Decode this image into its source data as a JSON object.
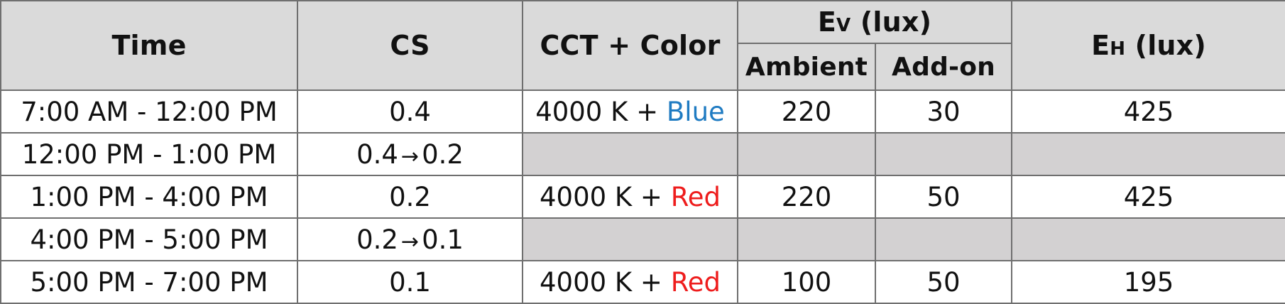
{
  "table": {
    "headers": {
      "time": "Time",
      "cs": "CS",
      "cct_color": "CCT + Color",
      "ev_main": "E",
      "ev_sub": "V",
      "ev_unit": "(lux)",
      "ev_ambient": "Ambient",
      "ev_addon": "Add-on",
      "eh_main": "E",
      "eh_sub": "H",
      "eh_unit": "(lux)"
    },
    "rows": [
      {
        "time": "7:00 AM - 12:00 PM",
        "cs_from": "0.4",
        "cs_arrow": "",
        "cs_to": "",
        "cct": "4000 K +",
        "color": "Blue",
        "color_class": "color-blue",
        "ambient": "220",
        "addon": "30",
        "eh": "425",
        "shaded": false
      },
      {
        "time": "12:00 PM - 1:00 PM",
        "cs_from": "0.4",
        "cs_arrow": "→",
        "cs_to": "0.2",
        "cct": "",
        "color": "",
        "color_class": "",
        "ambient": "",
        "addon": "",
        "eh": "",
        "shaded": true
      },
      {
        "time": "1:00 PM - 4:00 PM",
        "cs_from": "0.2",
        "cs_arrow": "",
        "cs_to": "",
        "cct": "4000 K +",
        "color": "Red",
        "color_class": "color-red",
        "ambient": "220",
        "addon": "50",
        "eh": "425",
        "shaded": false
      },
      {
        "time": "4:00 PM - 5:00 PM",
        "cs_from": "0.2",
        "cs_arrow": "→",
        "cs_to": "0.1",
        "cct": "",
        "color": "",
        "color_class": "",
        "ambient": "",
        "addon": "",
        "eh": "",
        "shaded": true
      },
      {
        "time": "5:00 PM - 7:00 PM",
        "cs_from": "0.1",
        "cs_arrow": "",
        "cs_to": "",
        "cct": "4000 K +",
        "color": "Red",
        "color_class": "color-red",
        "ambient": "100",
        "addon": "50",
        "eh": "195",
        "shaded": false
      }
    ]
  },
  "colors": {
    "header_bg": "#dadada",
    "shaded_cell_bg": "#d3d1d2",
    "border": "#6f6f6f",
    "blue_text": "#1f7bc2",
    "red_text": "#ee1c1c"
  }
}
